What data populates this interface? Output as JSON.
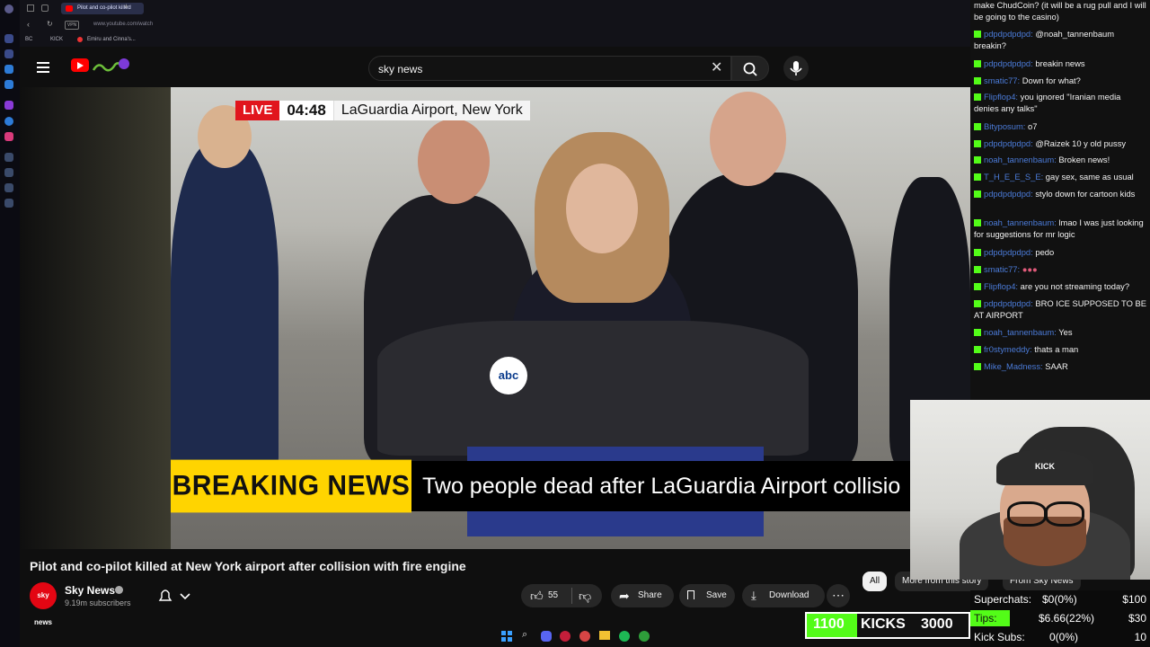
{
  "browser": {
    "tab_title": "Pilot and co-pilot killed",
    "new_tab": "+",
    "url": "www.youtube.com/watch",
    "bookmarks": [
      "BC",
      "KICK",
      "Emiru and Cinna's..."
    ]
  },
  "youtube": {
    "search_query": "sky news"
  },
  "video": {
    "live_label": "LIVE",
    "clock": "04:48",
    "location": "LaGuardia Airport, New York",
    "breaking_label": "BREAKING NEWS",
    "headline": "Two people dead after LaGuardia Airport collisio",
    "title": "Pilot and co-pilot killed at New York airport after collision with fire engine"
  },
  "channel": {
    "avatar_text": "sky news",
    "name": "Sky News",
    "subscribers": "9.19m subscribers"
  },
  "actions": {
    "likes": "55",
    "share": "Share",
    "save": "Save",
    "download": "Download"
  },
  "chips": [
    "All",
    "More from this story",
    "From Sky News"
  ],
  "chat": {
    "messages": [
      {
        "user": "",
        "text": "make ChudCoin? (it will be a rug pull and I will be going to the casino)"
      },
      {
        "user": "pdpdpdpdpd:",
        "text": "@noah_tannenbaum breakin?"
      },
      {
        "user": "pdpdpdpdpd:",
        "text": "breakin news"
      },
      {
        "user": "smatic77:",
        "text": "Down for what?"
      },
      {
        "user": "Flipflop4:",
        "text": "you ignored \"Iranian media denies any talks\""
      },
      {
        "user": "Bityposum:",
        "text": "o7"
      },
      {
        "user": "pdpdpdpdpd:",
        "text": "@Raizek 10 y old pussy"
      },
      {
        "user": "noah_tannenbaum:",
        "text": "Broken news!"
      },
      {
        "user": "T_H_E_E_S_E:",
        "text": "gay sex, same as usual"
      },
      {
        "user": "pdpdpdpdpd:",
        "text": "stylo down for cartoon kids"
      },
      {
        "user": "noah_tannenbaum:",
        "text": "lmao I was just looking for suggestions for mr logic"
      },
      {
        "user": "pdpdpdpdpd:",
        "text": "pedo"
      },
      {
        "user": "smatic77:",
        "text": ""
      },
      {
        "user": "Flipflop4:",
        "text": "are you not streaming today?"
      },
      {
        "user": "pdpdpdpdpd:",
        "text": "BRO ICE SUPPOSED TO BE AT AIRPORT"
      },
      {
        "user": "noah_tannenbaum:",
        "text": "Yes"
      },
      {
        "user": "fr0stymeddy:",
        "text": "thats a man"
      },
      {
        "user": "Mike_Madness:",
        "text": "SAAR"
      }
    ]
  },
  "kicks": {
    "current": "1100",
    "label": "KICKS",
    "goal": "3000"
  },
  "stats": {
    "superchats": {
      "label": "Superchats:",
      "value": "$0(0%)",
      "goal": "$100"
    },
    "tips": {
      "label": "Tips:",
      "value": "$6.66(22%)",
      "goal": "$30"
    },
    "subs": {
      "label": "Kick Subs:",
      "value": "0(0%)",
      "goal": "10"
    }
  },
  "webcam": {
    "cap_text": "KICK"
  },
  "colors": {
    "kick_green": "#53fc18",
    "live_red": "#e1151d",
    "breaking_yellow": "#ffd400",
    "chat_user": "#4b7bd8"
  }
}
